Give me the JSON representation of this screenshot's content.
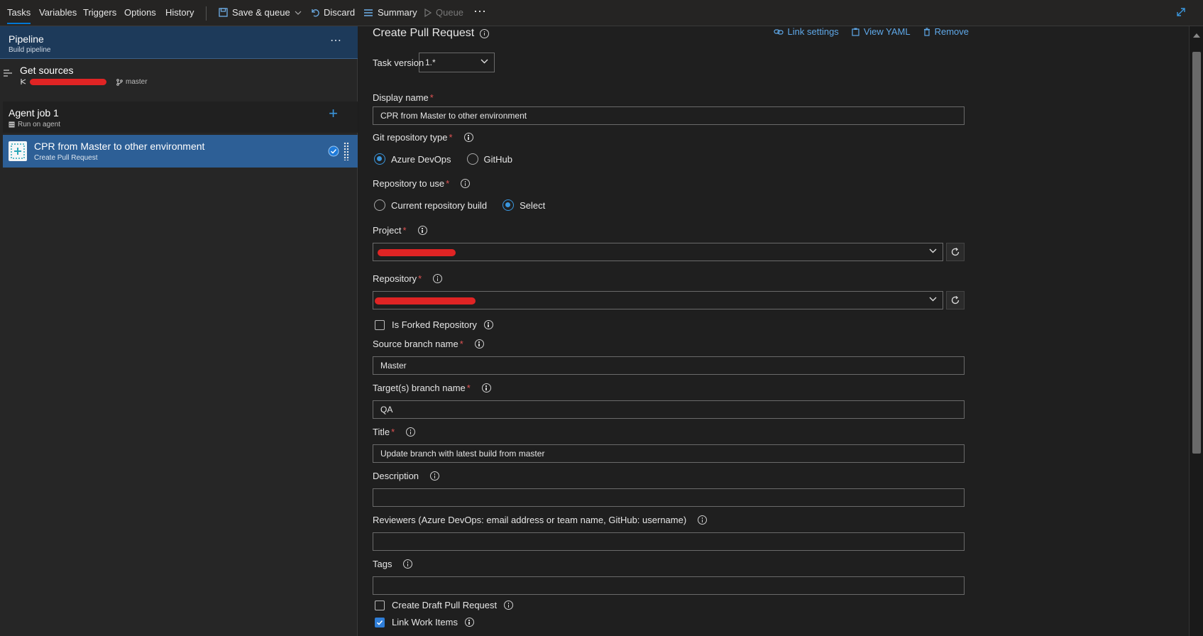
{
  "topbar": {
    "tabs": [
      "Tasks",
      "Variables",
      "Triggers",
      "Options",
      "History"
    ],
    "save_queue": "Save & queue",
    "discard": "Discard",
    "summary": "Summary",
    "queue": "Queue",
    "more": "⋯"
  },
  "left": {
    "pipeline_title": "Pipeline",
    "pipeline_sub": "Build pipeline",
    "more": "⋯",
    "get_sources": "Get sources",
    "branch": "master",
    "agent_job_title": "Agent job 1",
    "agent_job_sub": "Run on agent",
    "task_title": "CPR from Master to other environment",
    "task_sub": "Create Pull Request"
  },
  "form": {
    "heading": "Create Pull Request",
    "link_settings": "Link settings",
    "view_yaml": "View YAML",
    "remove": "Remove",
    "task_version_label": "Task version",
    "task_version_value": "1.*",
    "display_name_label": "Display name",
    "display_name_value": "CPR from Master to other environment",
    "git_repo_type_label": "Git repository type",
    "git_repo_options": [
      "Azure DevOps",
      "GitHub"
    ],
    "repo_to_use_label": "Repository to use",
    "repo_to_use_options": [
      "Current repository build",
      "Select"
    ],
    "project_label": "Project",
    "repository_label": "Repository",
    "is_forked_label": "Is Forked Repository",
    "source_branch_label": "Source branch name",
    "source_branch_value": "Master",
    "target_branch_label": "Target(s) branch name",
    "target_branch_value": "QA",
    "title_label": "Title",
    "title_value": "Update branch with latest build from master",
    "description_label": "Description",
    "description_value": "",
    "reviewers_label": "Reviewers (Azure DevOps: email address or team name, GitHub: username)",
    "reviewers_value": "",
    "tags_label": "Tags",
    "tags_value": "",
    "draft_label": "Create Draft Pull Request",
    "link_work_items_label": "Link Work Items",
    "required_mark": "*"
  },
  "colors": {
    "accent": "#0078d4",
    "link": "#5fa8e8",
    "selected_task": "#2d5f96",
    "pipeline_header": "#1d3a5a",
    "required": "#e05252",
    "redaction": "#e02424"
  }
}
